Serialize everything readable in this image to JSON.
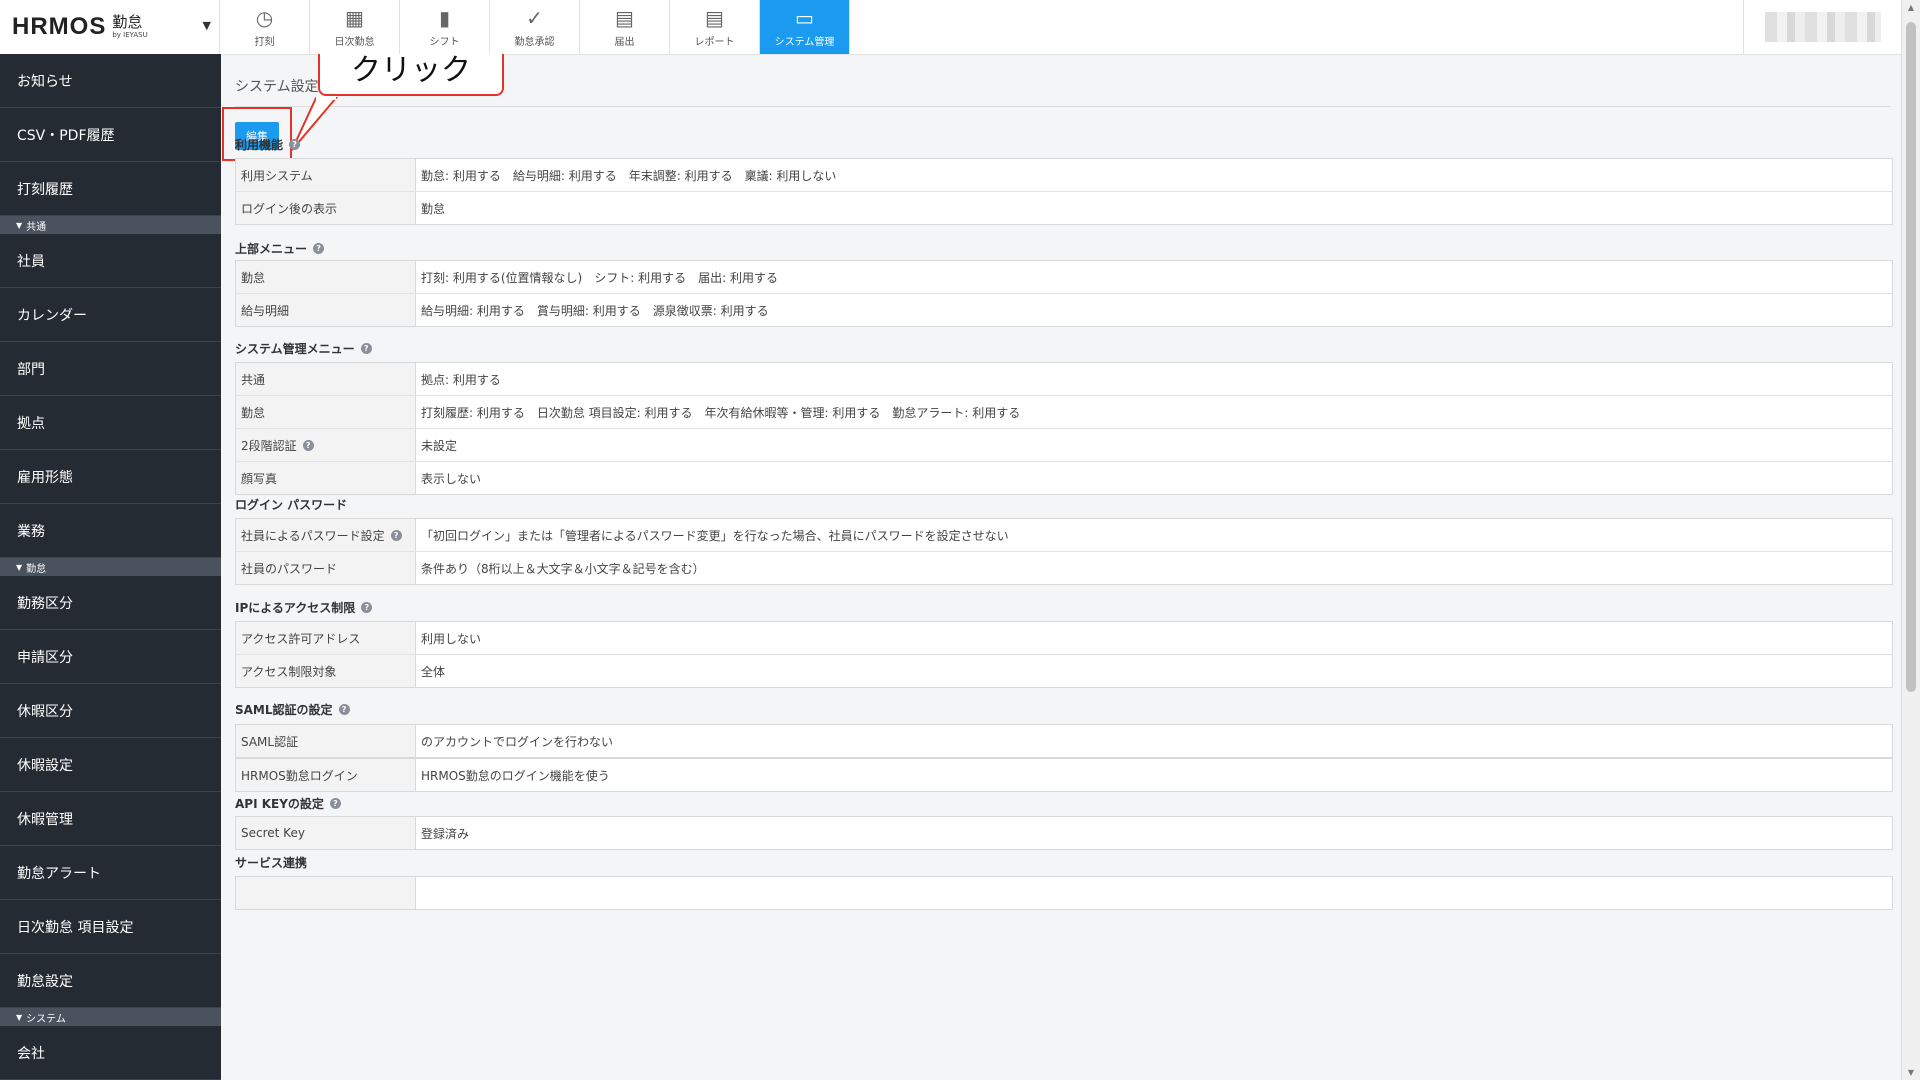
{
  "header": {
    "logo": "HRMOS",
    "logo_kintai": "勤怠",
    "logo_by": "by IEYASU",
    "nav": [
      {
        "label": "打刻",
        "icon": "clock-icon"
      },
      {
        "label": "日次勤怠",
        "icon": "calendar-icon"
      },
      {
        "label": "シフト",
        "icon": "notebook-icon"
      },
      {
        "label": "勤怠承認",
        "icon": "check-icon"
      },
      {
        "label": "届出",
        "icon": "document-upload-icon"
      },
      {
        "label": "レポート",
        "icon": "report-icon"
      },
      {
        "label": "システム管理",
        "icon": "monitor-icon",
        "active": true
      }
    ]
  },
  "sidebar": {
    "items": [
      {
        "type": "item",
        "label": "お知らせ"
      },
      {
        "type": "item",
        "label": "CSV・PDF履歴"
      },
      {
        "type": "item",
        "label": "打刻履歴"
      },
      {
        "type": "section",
        "label": "共通"
      },
      {
        "type": "item",
        "label": "社員"
      },
      {
        "type": "item",
        "label": "カレンダー"
      },
      {
        "type": "item",
        "label": "部門"
      },
      {
        "type": "item",
        "label": "拠点"
      },
      {
        "type": "item",
        "label": "雇用形態"
      },
      {
        "type": "item",
        "label": "業務"
      },
      {
        "type": "section",
        "label": "勤怠"
      },
      {
        "type": "item",
        "label": "勤務区分"
      },
      {
        "type": "item",
        "label": "申請区分"
      },
      {
        "type": "item",
        "label": "休暇区分"
      },
      {
        "type": "item",
        "label": "休暇設定"
      },
      {
        "type": "item",
        "label": "休暇管理"
      },
      {
        "type": "item",
        "label": "勤怠アラート"
      },
      {
        "type": "item",
        "label": "日次勤怠 項目設定"
      },
      {
        "type": "item",
        "label": "勤怠設定"
      },
      {
        "type": "section",
        "label": "システム"
      },
      {
        "type": "item",
        "label": "会社"
      }
    ]
  },
  "main": {
    "title": "システム設定",
    "edit_label": "編集",
    "callout": "クリック",
    "sections": [
      {
        "title": "利用機能",
        "help": true,
        "rows": [
          {
            "label": "利用システム",
            "value": "勤怠: 利用する　給与明細: 利用する　年末調整: 利用する　稟議: 利用しない"
          },
          {
            "label": "ログイン後の表示",
            "value": "勤怠"
          }
        ]
      },
      {
        "title": "上部メニュー",
        "help": true,
        "rows": [
          {
            "label": "勤怠",
            "value": "打刻: 利用する(位置情報なし)　シフト: 利用する　届出: 利用する"
          },
          {
            "label": "給与明細",
            "value": "給与明細: 利用する　賞与明細: 利用する　源泉徴収票: 利用する"
          }
        ]
      },
      {
        "title": "システム管理メニュー",
        "help": true,
        "rows": [
          {
            "label": "共通",
            "value": "拠点: 利用する"
          },
          {
            "label": "勤怠",
            "value": "打刻履歴: 利用する　日次勤怠 項目設定: 利用する　年次有給休暇等・管理: 利用する　勤怠アラート: 利用する"
          },
          {
            "label": "2段階認証",
            "help": true,
            "value": "未設定"
          },
          {
            "label": "顔写真",
            "value": "表示しない"
          }
        ]
      },
      {
        "title": "ログイン パスワード",
        "help": false,
        "rows": [
          {
            "label": "社員によるパスワード設定",
            "help": true,
            "value": "「初回ログイン」または「管理者によるパスワード変更」を行なった場合、社員にパスワードを設定させない"
          },
          {
            "label": "社員のパスワード",
            "value": "条件あり（8桁以上＆大文字＆小文字＆記号を含む）"
          }
        ]
      },
      {
        "title": "IPによるアクセス制限",
        "help": true,
        "rows": [
          {
            "label": "アクセス許可アドレス",
            "value": "利用しない"
          },
          {
            "label": "アクセス制限対象",
            "value": "全体"
          }
        ]
      },
      {
        "title": "SAML認証の設定",
        "help": true,
        "rows": [
          {
            "label": " SAML認証",
            "value": "のアカウントでログインを行わない"
          }
        ]
      },
      {
        "title": "",
        "help": false,
        "rows": [
          {
            "label": "HRMOS勤怠ログイン",
            "value": "HRMOS勤怠のログイン機能を使う"
          }
        ]
      },
      {
        "title": "API KEYの設定",
        "help": true,
        "rows": [
          {
            "label": "Secret Key",
            "value": "登録済み"
          }
        ]
      },
      {
        "title": "サービス連携",
        "help": false,
        "rows": [
          {
            "label": "",
            "value": ""
          }
        ]
      }
    ]
  }
}
